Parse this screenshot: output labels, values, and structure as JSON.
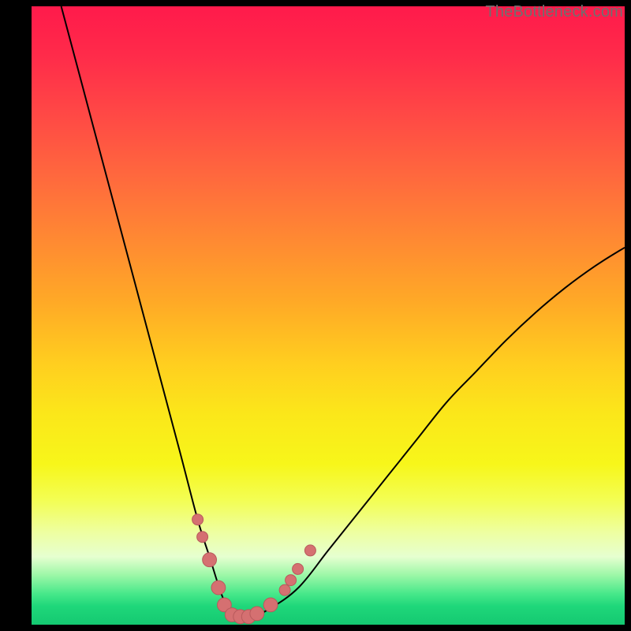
{
  "watermark": {
    "text": "TheBottleneck.com"
  },
  "colors": {
    "page_background": "#000000",
    "curve": "#000000",
    "dot_fill": "#d57071",
    "dot_stroke": "#b85a5c",
    "watermark": "#6f6f6f"
  },
  "chart_data": {
    "type": "line",
    "title": "",
    "xlabel": "",
    "ylabel": "",
    "xlim": [
      0,
      100
    ],
    "ylim": [
      0,
      100
    ],
    "grid": false,
    "legend": false,
    "series": [
      {
        "name": "bottleneck-curve",
        "x": [
          5,
          10,
          15,
          20,
          25,
          28,
          30,
          32,
          33.5,
          35,
          37,
          40,
          45,
          50,
          55,
          60,
          65,
          70,
          75,
          80,
          85,
          90,
          95,
          100
        ],
        "y": [
          100,
          82,
          64,
          46,
          28,
          17,
          11,
          5,
          2,
          1.3,
          1.3,
          2.5,
          6,
          12,
          18,
          24,
          30,
          36,
          41,
          46,
          50.5,
          54.5,
          58,
          61
        ]
      }
    ],
    "markers": [
      {
        "x": 28.0,
        "y": 17.0,
        "r": 1.1
      },
      {
        "x": 28.8,
        "y": 14.2,
        "r": 1.1
      },
      {
        "x": 30.0,
        "y": 10.5,
        "r": 1.4
      },
      {
        "x": 31.5,
        "y": 6.0,
        "r": 1.4
      },
      {
        "x": 32.5,
        "y": 3.2,
        "r": 1.4
      },
      {
        "x": 33.8,
        "y": 1.6,
        "r": 1.4
      },
      {
        "x": 35.2,
        "y": 1.3,
        "r": 1.4
      },
      {
        "x": 36.6,
        "y": 1.3,
        "r": 1.4
      },
      {
        "x": 38.0,
        "y": 1.8,
        "r": 1.4
      },
      {
        "x": 40.3,
        "y": 3.2,
        "r": 1.4
      },
      {
        "x": 42.7,
        "y": 5.6,
        "r": 1.1
      },
      {
        "x": 43.7,
        "y": 7.2,
        "r": 1.1
      },
      {
        "x": 44.9,
        "y": 9.0,
        "r": 1.1
      },
      {
        "x": 47.0,
        "y": 12.0,
        "r": 1.1
      }
    ]
  }
}
